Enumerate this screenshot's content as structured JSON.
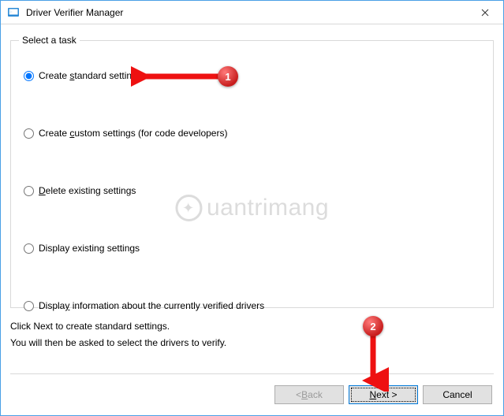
{
  "window": {
    "title": "Driver Verifier Manager"
  },
  "group": {
    "legend": "Select a task",
    "options": {
      "create_standard": "Create standard settings",
      "create_custom": "Create custom settings (for code developers)",
      "delete_existing": "Delete existing settings",
      "display_existing": "Display existing settings",
      "display_info": "Display information about the currently verified drivers"
    }
  },
  "info": {
    "line1": "Click Next to create standard settings.",
    "line2": "You will then be asked to select the drivers to verify."
  },
  "buttons": {
    "back": "< Back",
    "next": "Next >",
    "cancel": "Cancel"
  },
  "annotations": {
    "step1": "1",
    "step2": "2"
  },
  "watermark": {
    "text": "uantrimang"
  },
  "accent_color": "#0078d7",
  "arrow_color": "#e11"
}
